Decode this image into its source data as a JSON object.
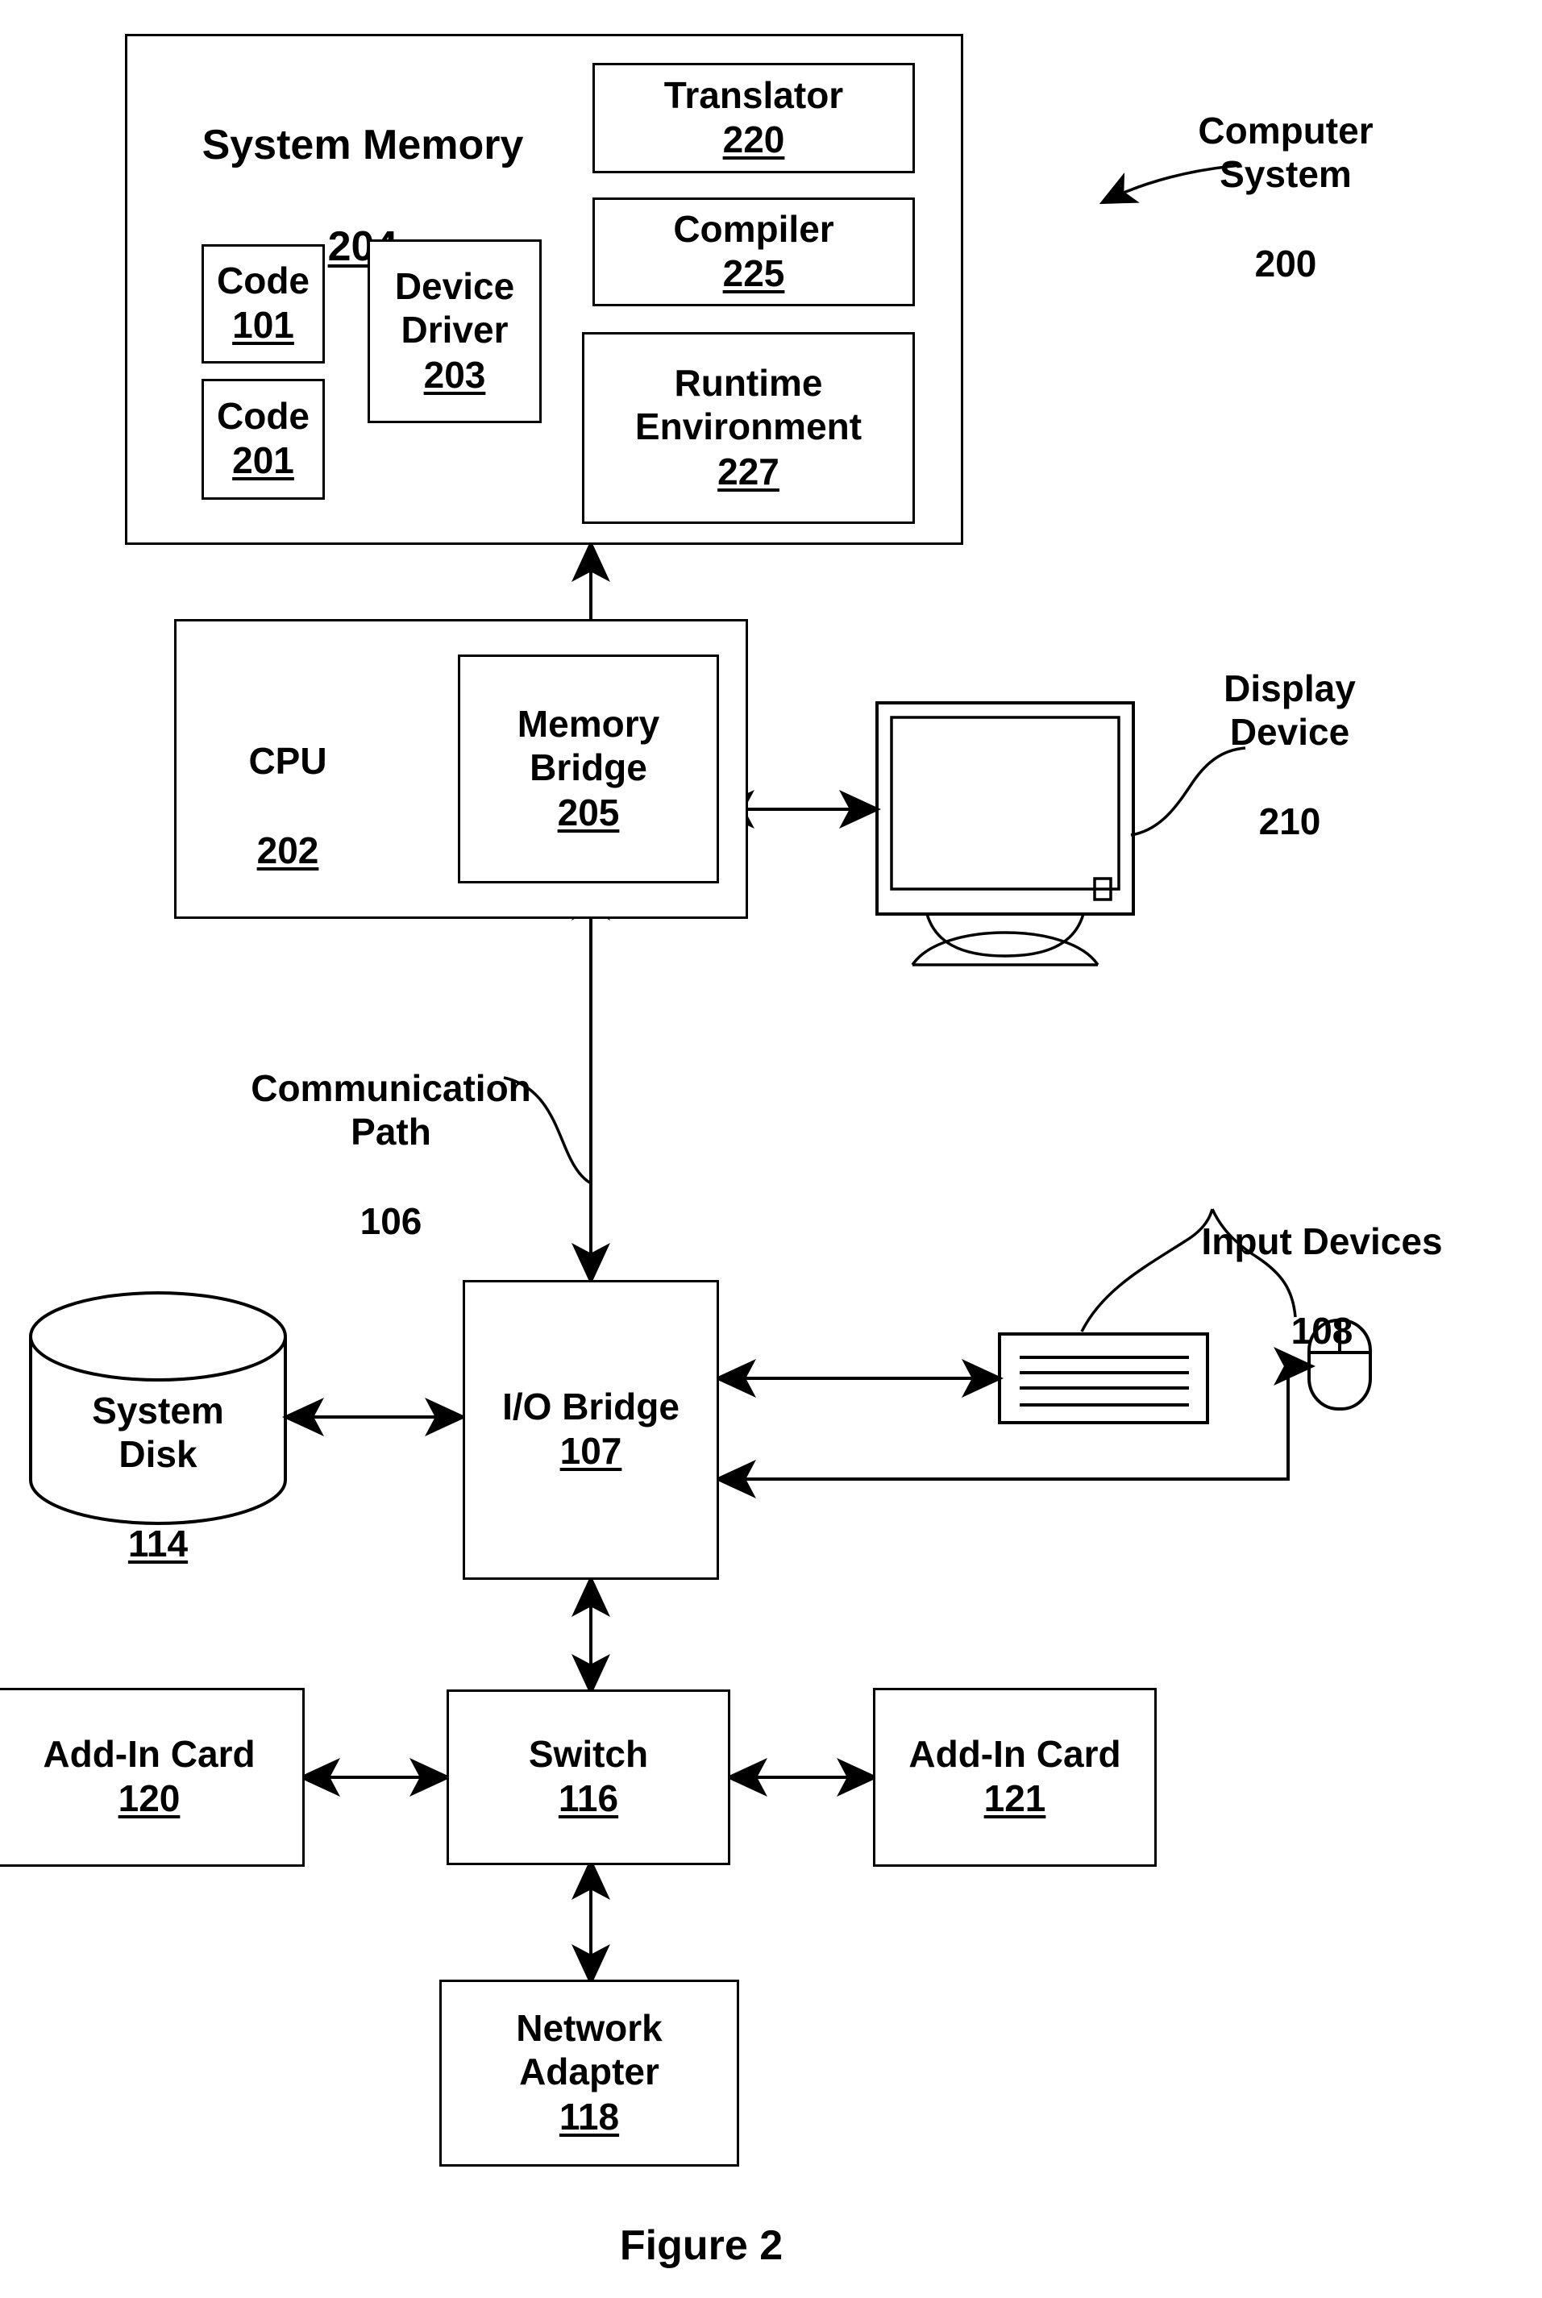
{
  "figure": {
    "caption": "Figure 2"
  },
  "annotations": {
    "computer_system": {
      "label": "Computer\nSystem",
      "number": "200"
    },
    "display_device": {
      "label": "Display\nDevice",
      "number": "210"
    },
    "communication_path": {
      "label": "Communication\nPath",
      "number": "106"
    },
    "input_devices": {
      "label": "Input Devices",
      "number": "108"
    }
  },
  "blocks": {
    "system_memory": {
      "label": "System Memory",
      "number": "204"
    },
    "code_101": {
      "label": "Code",
      "number": "101"
    },
    "code_201": {
      "label": "Code",
      "number": "201"
    },
    "device_driver": {
      "label": "Device\nDriver",
      "number": "203"
    },
    "translator": {
      "label": "Translator",
      "number": "220"
    },
    "compiler": {
      "label": "Compiler",
      "number": "225"
    },
    "runtime_environment": {
      "label": "Runtime\nEnvironment",
      "number": "227"
    },
    "cpu": {
      "label": "CPU",
      "number": "202"
    },
    "memory_bridge": {
      "label": "Memory\nBridge",
      "number": "205"
    },
    "system_disk": {
      "label": "System\nDisk",
      "number": "114"
    },
    "io_bridge": {
      "label": "I/O Bridge",
      "number": "107"
    },
    "switch": {
      "label": "Switch",
      "number": "116"
    },
    "add_in_card_120": {
      "label": "Add-In Card",
      "number": "120"
    },
    "add_in_card_121": {
      "label": "Add-In Card",
      "number": "121"
    },
    "network_adapter": {
      "label": "Network\nAdapter",
      "number": "118"
    }
  },
  "icons": {
    "display": "monitor-icon",
    "keyboard": "keyboard-icon",
    "mouse": "mouse-icon",
    "disk": "cylinder-disk-icon"
  },
  "colors": {
    "ink": "#000000",
    "paper": "#ffffff"
  }
}
